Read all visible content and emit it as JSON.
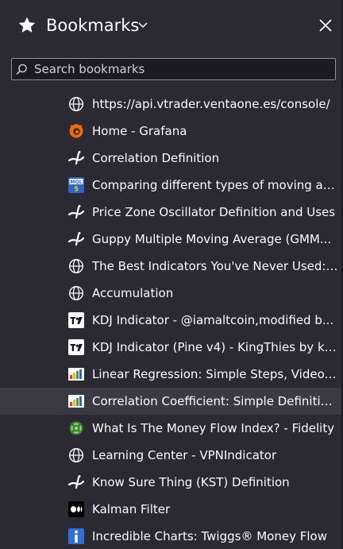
{
  "header": {
    "title": "Bookmarks",
    "icon_star": "star-icon",
    "icon_chevron": "chevron-down-icon",
    "icon_close": "close-icon"
  },
  "search": {
    "placeholder": "Search bookmarks",
    "value": "",
    "icon": "search-icon"
  },
  "bookmarks": [
    {
      "label": "https://api.vtrader.ventaone.es/console/",
      "icon": "globe-icon"
    },
    {
      "label": "Home - Grafana",
      "icon": "grafana-icon"
    },
    {
      "label": "Correlation Definition",
      "icon": "investopedia-icon"
    },
    {
      "label": "Comparing different types of moving av...",
      "icon": "mql5-icon"
    },
    {
      "label": "Price Zone Oscillator Definition and Uses",
      "icon": "investopedia-icon"
    },
    {
      "label": "Guppy Multiple Moving Average (GMM...",
      "icon": "investopedia-icon"
    },
    {
      "label": "The Best Indicators You've Never Used: ...",
      "icon": "globe-icon"
    },
    {
      "label": "Accumulation",
      "icon": "globe-icon"
    },
    {
      "label": "KDJ Indicator - @iamaltcoin,modified b...",
      "icon": "tradingview-icon"
    },
    {
      "label": "KDJ Indicator (Pine v4) - KingThies by ki...",
      "icon": "tradingview-icon"
    },
    {
      "label": "Linear Regression: Simple Steps, Video. ...",
      "icon": "statistics-howto-icon"
    },
    {
      "label": "Correlation Coefficient: Simple Definitio...",
      "icon": "statistics-howto-icon"
    },
    {
      "label": "What Is The Money Flow Index? - Fidelity",
      "icon": "fidelity-icon"
    },
    {
      "label": "Learning Center - VPNIndicator",
      "icon": "globe-icon"
    },
    {
      "label": "Know Sure Thing (KST) Definition",
      "icon": "investopedia-icon"
    },
    {
      "label": "Kalman Filter",
      "icon": "medium-icon"
    },
    {
      "label": "Incredible Charts: Twiggs® Money Flow",
      "icon": "info-icon"
    }
  ],
  "colors": {
    "background": "#2b2a33",
    "text": "#fbfbfe",
    "search_bg": "#1c1b22",
    "row_hover": "#3a3944",
    "grafana": "#f46800",
    "fidelity": "#368727",
    "mql5": "#2b66c9",
    "info": "#2f6fd8"
  }
}
